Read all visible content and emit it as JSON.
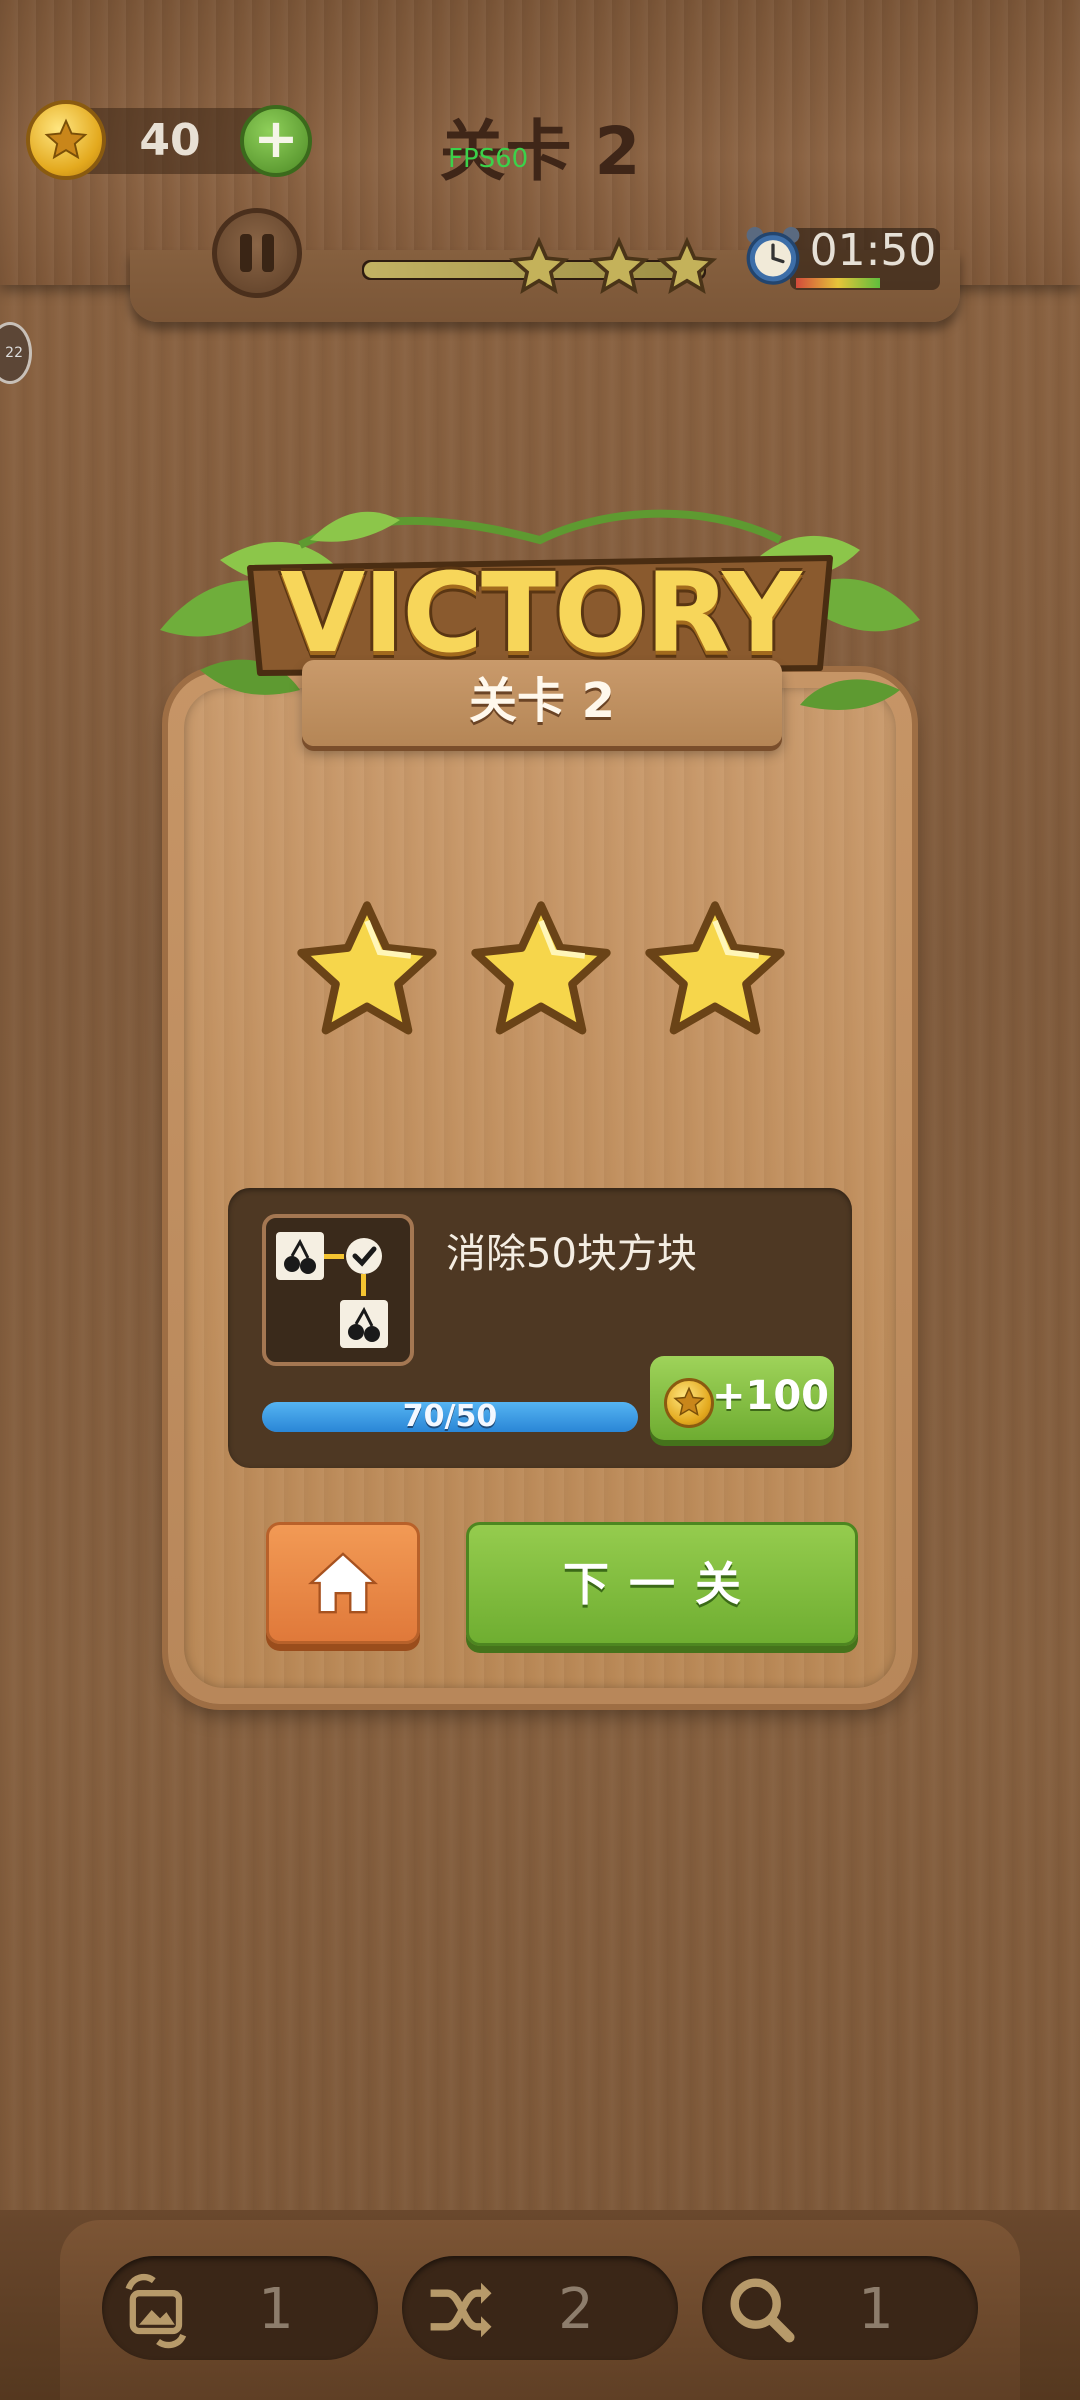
{
  "header": {
    "coins": "40",
    "add_label": "+",
    "level_title": "关卡 2",
    "fps": "FPS60",
    "timer": "01:50",
    "stars_earned": 3,
    "side_badge": "22"
  },
  "victory": {
    "title": "VICTORY",
    "level_label": "关卡 2",
    "stars_earned": 3,
    "stars_total": 3
  },
  "quest": {
    "title": "消除50块方块",
    "progress_text": "70/50",
    "progress_fraction": 1.0,
    "reward": "+100"
  },
  "buttons": {
    "next_label": "下一关"
  },
  "boosters": [
    {
      "icon": "swap-image-icon",
      "count": "1"
    },
    {
      "icon": "shuffle-icon",
      "count": "2"
    },
    {
      "icon": "magnifier-icon",
      "count": "1"
    }
  ],
  "colors": {
    "accent_green": "#7bbd3c",
    "accent_orange": "#ef8a44",
    "coin_gold": "#f2c233",
    "progress_blue": "#3a9ae5"
  }
}
